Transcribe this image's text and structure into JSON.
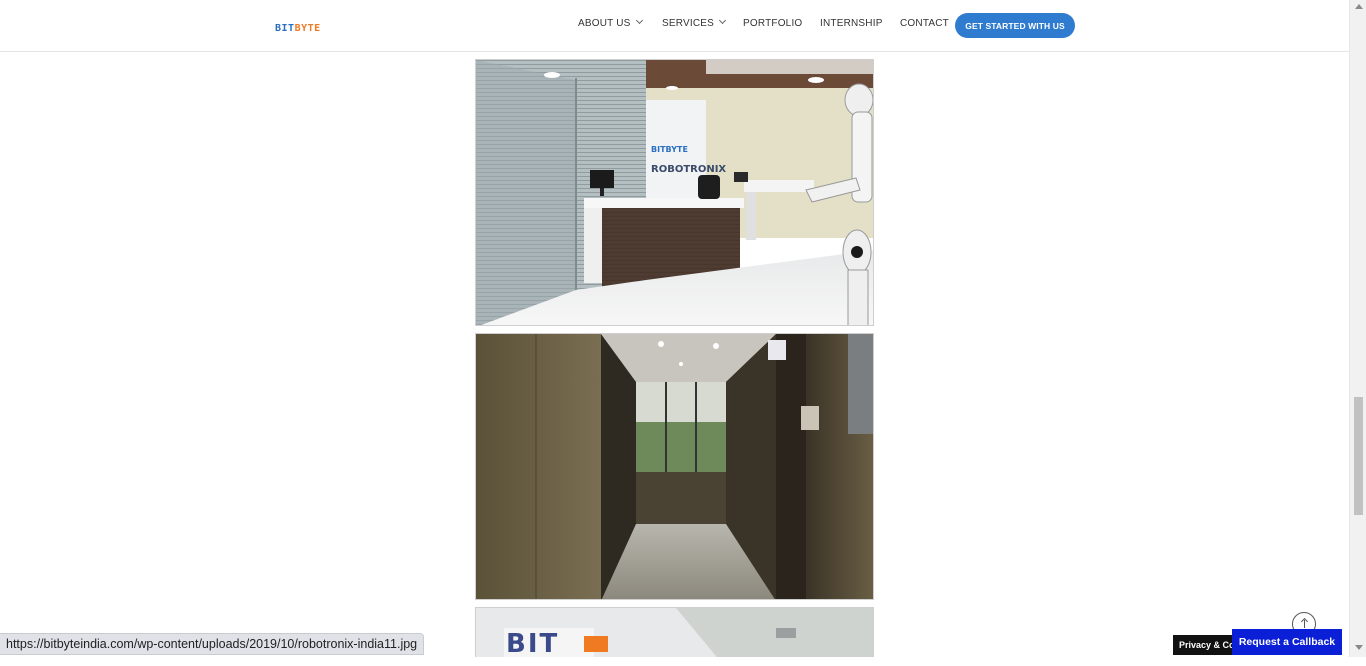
{
  "header": {
    "logo_part1": "BIT",
    "logo_part2": "BYTE",
    "nav": [
      {
        "label": "ABOUT US",
        "has_dropdown": true
      },
      {
        "label": "SERVICES",
        "has_dropdown": true
      },
      {
        "label": "PORTFOLIO",
        "has_dropdown": false
      },
      {
        "label": "INTERNSHIP",
        "has_dropdown": false
      },
      {
        "label": "CONTACT",
        "has_dropdown": false
      }
    ],
    "cta_label": "GET STARTED WITH US"
  },
  "gallery": {
    "photo1_desc": "office reception with robot",
    "photo1_sign_top": "BITBYTE",
    "photo1_sign_bottom": "ROBOTRONIX",
    "photo2_desc": "office corridor",
    "photo3_desc": "office wall with BITBYTE logo"
  },
  "status_bar": {
    "url": "https://bitbyteindia.com/wp-content/uploads/2019/10/robotronix-india11.jpg"
  },
  "footer_widgets": {
    "privacy_label": "Privacy & Cookies Policy",
    "callback_label": "Request a Callback",
    "back_to_top_icon": "arrow-up-icon"
  },
  "colors": {
    "logo_blue": "#2b6fc4",
    "logo_orange": "#f07a22",
    "cta_blue": "#2f7bd0",
    "callback_blue": "#0a1fd6"
  }
}
